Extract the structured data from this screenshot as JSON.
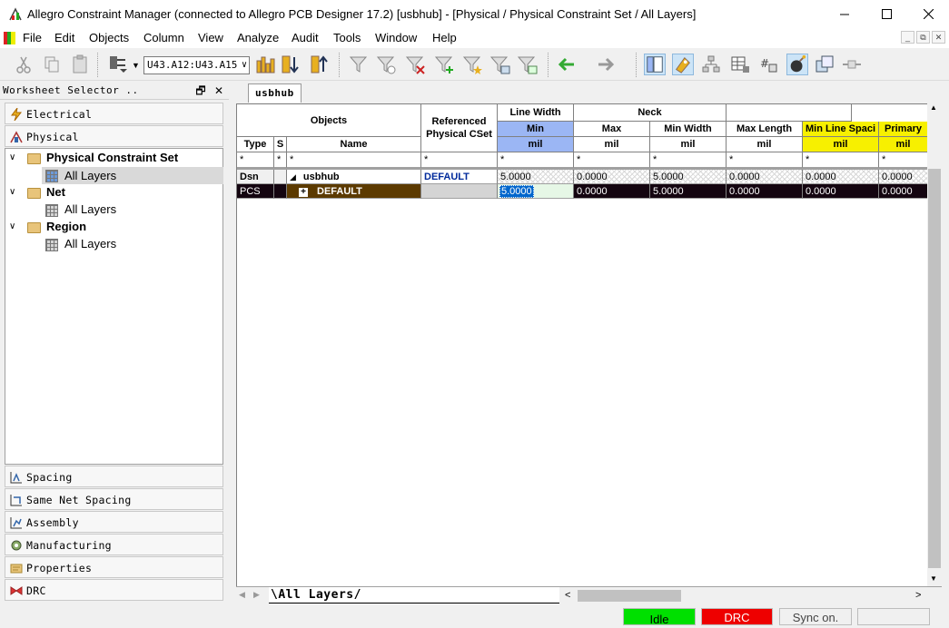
{
  "window": {
    "title": "Allegro Constraint Manager (connected to Allegro PCB Designer 17.2) [usbhub] - [Physical / Physical Constraint Set / All Layers]",
    "minimize_icon": "minimize-icon",
    "maximize_icon": "maximize-icon",
    "close_icon": "close-icon"
  },
  "menu": {
    "items": [
      "File",
      "Edit",
      "Objects",
      "Column",
      "View",
      "Analyze",
      "Audit",
      "Tools",
      "Window",
      "Help"
    ]
  },
  "toolbar": {
    "net_combo_value": "U43.A12:U43.A15"
  },
  "worksheet_selector": {
    "title": "Worksheet Selector ..",
    "categories_top": [
      {
        "label": "Electrical",
        "icon": "lightning-icon"
      },
      {
        "label": "Physical",
        "icon": "physical-icon"
      }
    ],
    "tree": {
      "pcs_label": "Physical Constraint Set",
      "pcs_child": "All Layers",
      "net_label": "Net",
      "net_child": "All Layers",
      "region_label": "Region",
      "region_child": "All Layers"
    },
    "categories_bottom": [
      {
        "label": "Spacing",
        "icon": "spacing-icon"
      },
      {
        "label": "Same Net Spacing",
        "icon": "same-net-spacing-icon"
      },
      {
        "label": "Assembly",
        "icon": "assembly-icon"
      },
      {
        "label": "Manufacturing",
        "icon": "manufacturing-icon"
      },
      {
        "label": "Properties",
        "icon": "properties-icon"
      },
      {
        "label": "DRC",
        "icon": "drc-icon"
      }
    ]
  },
  "document_tab": "usbhub",
  "grid": {
    "objects_header": "Objects",
    "ref_header": "Referenced Physical CSet",
    "line_width_header": "Line Width",
    "neck_header": "Neck",
    "type_header": "Type",
    "s_header": "S",
    "name_header": "Name",
    "min_header": "Min",
    "max_header": "Max",
    "min_width_header": "Min Width",
    "max_length_header": "Max Length",
    "min_line_spacing_header": "Min Line Spaci",
    "primary_header": "Primary",
    "unit": "mil",
    "filter": "*",
    "rows": [
      {
        "type": "Dsn",
        "s": "",
        "name": "usbhub",
        "ref": "DEFAULT",
        "min": "5.0000",
        "max": "0.0000",
        "min_width": "5.0000",
        "max_length": "0.0000",
        "min_line_spacing": "0.0000",
        "primary": "0.0000"
      },
      {
        "type": "PCS",
        "s": "",
        "name": "DEFAULT",
        "ref": "",
        "min": "5.0000",
        "max": "0.0000",
        "min_width": "5.0000",
        "max_length": "0.0000",
        "min_line_spacing": "0.0000",
        "primary": "0.0000"
      }
    ]
  },
  "sheet_tab": "All Layers",
  "status": {
    "idle": "Idle",
    "drc": "DRC",
    "sync": "Sync on.",
    "idle_color": "#00e000",
    "drc_color": "#ee0000"
  }
}
